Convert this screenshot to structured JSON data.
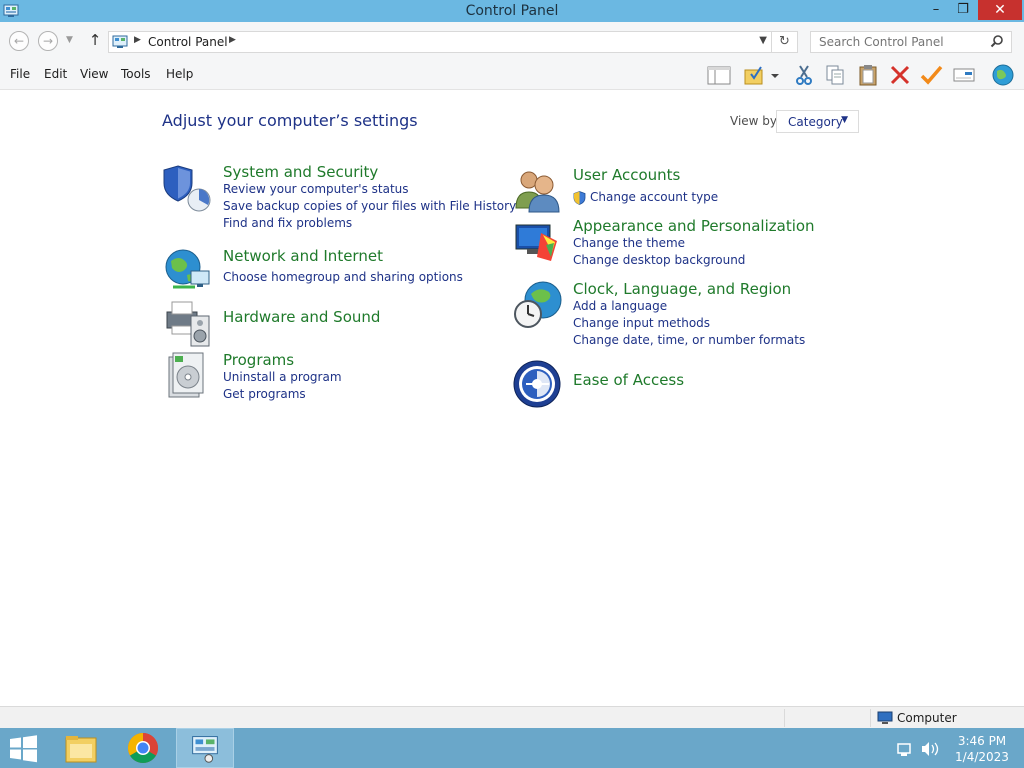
{
  "window": {
    "title": "Control Panel",
    "controls": {
      "minimize": "–",
      "maximize": "❐",
      "close": "✕"
    }
  },
  "address": {
    "breadcrumb": "Control Panel",
    "search_placeholder": "Search Control Panel"
  },
  "menu": [
    "File",
    "Edit",
    "View",
    "Tools",
    "Help"
  ],
  "toolbar": {
    "icons": [
      "layout-pane-icon",
      "folder-checkmark-icon",
      "cut-icon",
      "copy-icon",
      "paste-icon",
      "delete-icon",
      "check-icon",
      "properties-icon",
      "globe-icon"
    ]
  },
  "main": {
    "heading": "Adjust your computer’s settings",
    "view_by_label": "View by:",
    "view_by_value": "Category",
    "categories_left": [
      {
        "title": "System and Security",
        "links": [
          "Review your computer's status",
          "Save backup copies of your files with File History",
          "Find and fix problems"
        ]
      },
      {
        "title": "Network and Internet",
        "links": [
          "Choose homegroup and sharing options"
        ]
      },
      {
        "title": "Hardware and Sound",
        "links": []
      },
      {
        "title": "Programs",
        "links": [
          "Uninstall a program",
          "Get programs"
        ]
      }
    ],
    "categories_right": [
      {
        "title": "User Accounts",
        "links": [
          "Change account type"
        ]
      },
      {
        "title": "Appearance and Personalization",
        "links": [
          "Change the theme",
          "Change desktop background"
        ]
      },
      {
        "title": "Clock, Language, and Region",
        "links": [
          "Add a language",
          "Change input methods",
          "Change date, time, or number formats"
        ]
      },
      {
        "title": "Ease of Access",
        "links": []
      }
    ]
  },
  "statusbar": {
    "zone": "Computer"
  },
  "taskbar": {
    "apps": [
      "file-explorer",
      "google-chrome",
      "control-panel"
    ],
    "time": "3:46 PM",
    "date": "1/4/2023"
  },
  "colors": {
    "titlebar": "#6bb8e2",
    "close_button": "#c7312e",
    "category_title": "#1f7a2b",
    "link": "#1e3287",
    "taskbar": "#6aa7c9"
  }
}
